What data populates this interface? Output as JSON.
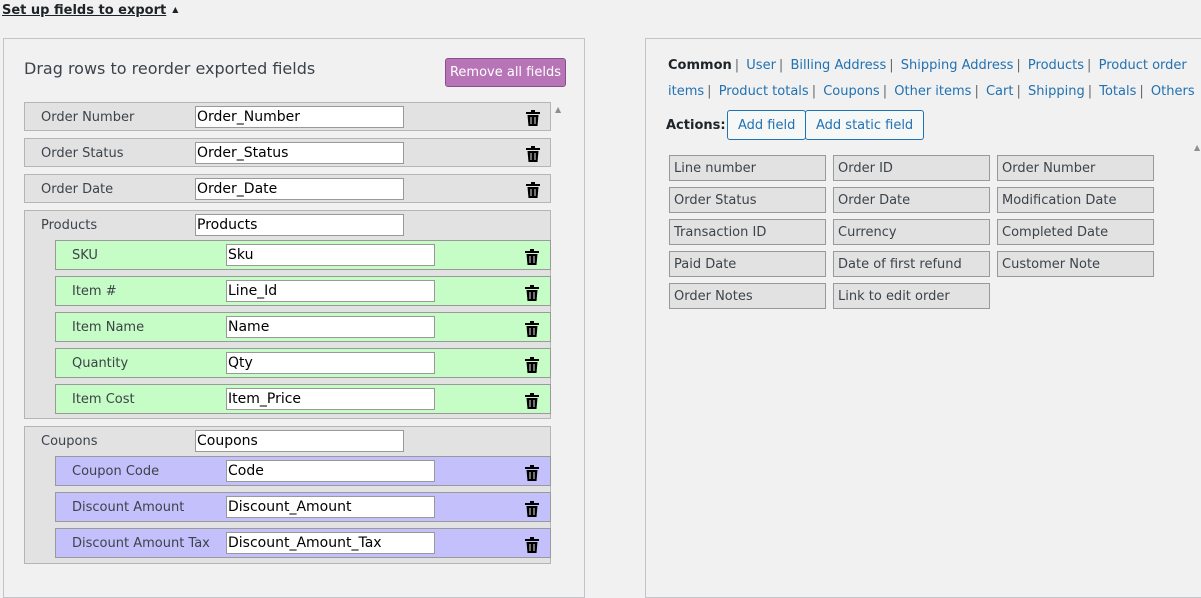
{
  "section": {
    "title": "Set up fields to export",
    "arrow": "▲"
  },
  "left": {
    "title": "Drag rows to reorder exported fields",
    "remove_all_label": "Remove all fields",
    "rows": [
      {
        "label": "Order Number",
        "value": "Order_Number"
      },
      {
        "label": "Order Status",
        "value": "Order_Status"
      },
      {
        "label": "Order Date",
        "value": "Order_Date"
      }
    ],
    "products": {
      "label": "Products",
      "value": "Products",
      "items": [
        {
          "label": "SKU",
          "value": "Sku"
        },
        {
          "label": "Item #",
          "value": "Line_Id"
        },
        {
          "label": "Item Name",
          "value": "Name"
        },
        {
          "label": "Quantity",
          "value": "Qty"
        },
        {
          "label": "Item Cost",
          "value": "Item_Price"
        }
      ]
    },
    "coupons": {
      "label": "Coupons",
      "value": "Coupons",
      "items": [
        {
          "label": "Coupon Code",
          "value": "Code"
        },
        {
          "label": "Discount Amount",
          "value": "Discount_Amount"
        },
        {
          "label": "Discount Amount Tax",
          "value": "Discount_Amount_Tax"
        }
      ]
    }
  },
  "right": {
    "tabs": [
      "Common",
      "User",
      "Billing Address",
      "Shipping Address",
      "Products",
      "Product order items",
      "Product totals",
      "Coupons",
      "Other items",
      "Cart",
      "Shipping",
      "Totals",
      "Others"
    ],
    "active_tab": "Common",
    "actions_label": "Actions:",
    "add_field_label": "Add field",
    "add_static_label": "Add static field",
    "fields": [
      "Line number",
      "Order ID",
      "Order Number",
      "Order Status",
      "Order Date",
      "Modification Date",
      "Transaction ID",
      "Currency",
      "Completed Date",
      "Paid Date",
      "Date of first refund",
      "Customer Note",
      "Order Notes",
      "Link to edit order"
    ]
  },
  "colors": {
    "remove_button": "#b775b7",
    "product_rows": "#c6fcc5",
    "coupon_rows": "#c4c0fb",
    "link": "#2271b1"
  },
  "icons": {
    "delete": "trash-icon"
  }
}
